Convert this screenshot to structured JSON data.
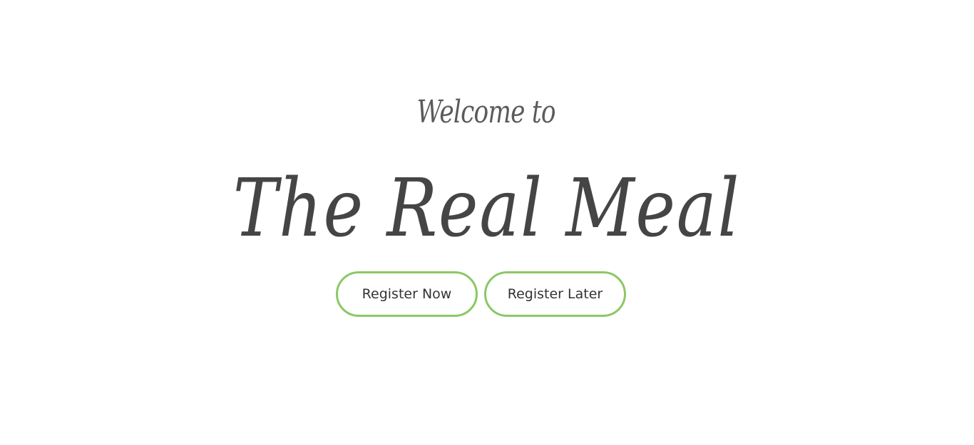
{
  "hero": {
    "welcome_text": "Welcome to",
    "title": "The Real Meal"
  },
  "actions": {
    "register_now_label": "Register Now",
    "register_later_label": "Register Later"
  },
  "colors": {
    "button_border": "#8bc865",
    "title_text": "#454545",
    "background": "#ffffff"
  }
}
